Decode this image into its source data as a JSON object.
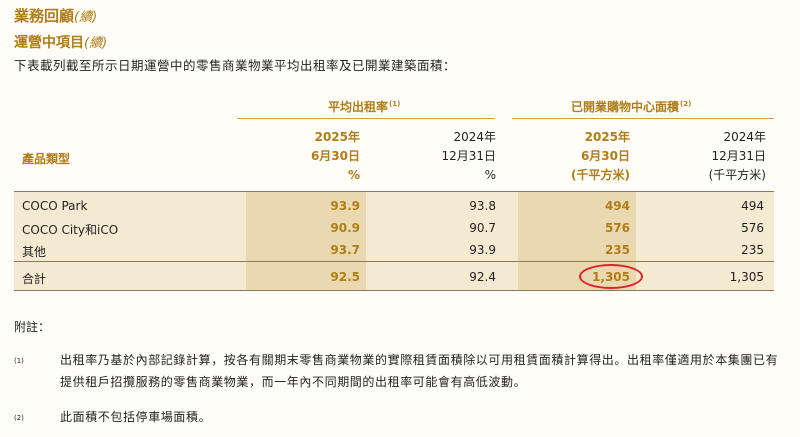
{
  "heading": {
    "title": "業務回顧",
    "title_cont": "(續)",
    "subtitle": "運營中項目",
    "subtitle_cont": "(續)"
  },
  "intro": "下表載列截至所示日期運營中的零售商業物業平均出租率及已開業建築面積：",
  "table": {
    "group_occupancy": {
      "label": "平均出租率",
      "note": "(1)"
    },
    "group_gfa": {
      "label": "已開業購物中心面積",
      "note": "(2)"
    },
    "product_label": "產品類型",
    "columns": [
      {
        "year": "2025年",
        "date": "6月30日",
        "unit": "%"
      },
      {
        "year": "2024年",
        "date": "12月31日",
        "unit": "%"
      },
      {
        "year": "2025年",
        "date": "6月30日",
        "unit": "(千平方米)"
      },
      {
        "year": "2024年",
        "date": "12月31日",
        "unit": "(千平方米)"
      }
    ],
    "rows": [
      {
        "name": "COCO Park",
        "values": [
          "93.9",
          "93.8",
          "494",
          "494"
        ]
      },
      {
        "name": "COCO City和iCO",
        "values": [
          "90.9",
          "90.7",
          "576",
          "576"
        ]
      },
      {
        "name": "其他",
        "values": [
          "93.7",
          "93.9",
          "235",
          "235"
        ]
      }
    ],
    "total": {
      "name": "合計",
      "values": [
        "92.5",
        "92.4",
        "1,305",
        "1,305"
      ]
    }
  },
  "notes": {
    "title": "附註：",
    "items": [
      {
        "mark": "(1)",
        "text": "出租率乃基於內部記錄計算，按各有關期末零售商業物業的實際租賃面積除以可用租賃面積計算得出。出租率僅適用於本集團已有提供租戶招攬服務的零售商業物業，而一年內不同期間的出租率可能會有高低波動。"
      },
      {
        "mark": "(2)",
        "text": "此面積不包括停車場面積。"
      }
    ]
  },
  "colors": {
    "gold": "#b07d18",
    "band": "#f4ead1",
    "highlight": "#ead9b0",
    "circle": "#e0212a"
  }
}
